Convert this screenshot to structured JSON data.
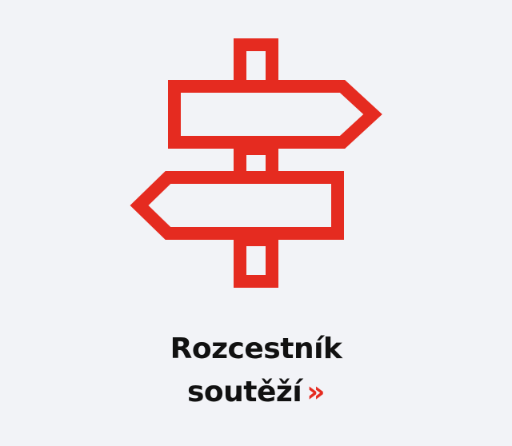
{
  "card": {
    "title_line1": "Rozcestník",
    "title_line2": "soutěží",
    "arrow": "»",
    "icon": "signpost-icon"
  },
  "colors": {
    "background": "#f2f3f7",
    "accent": "#e52b20",
    "text": "#111111"
  }
}
